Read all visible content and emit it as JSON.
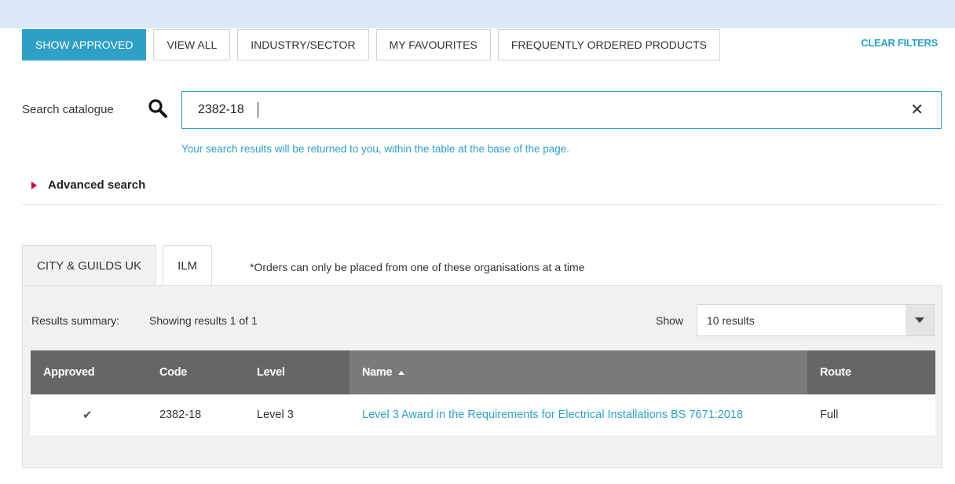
{
  "filters": {
    "show_approved": "SHOW APPROVED",
    "view_all": "VIEW ALL",
    "industry_sector": "INDUSTRY/SECTOR",
    "my_favourites": "MY FAVOURITES",
    "frequently_ordered": "FREQUENTLY ORDERED PRODUCTS",
    "clear_filters": "CLEAR FILTERS",
    "active": "show_approved"
  },
  "search": {
    "label": "Search catalogue",
    "value": "2382-18",
    "clear_glyph": "✕",
    "hint": "Your search results will be returned to you, within the table at the base of the page."
  },
  "advanced": {
    "label": "Advanced search"
  },
  "orgs": {
    "tabs": [
      {
        "label": "CITY & GUILDS UK",
        "active": true
      },
      {
        "label": "ILM",
        "active": false
      }
    ],
    "note": "*Orders can only be placed from one of these organisations at a time"
  },
  "results": {
    "summary_label": "Results summary:",
    "summary_text": "Showing results 1 of 1",
    "show_label": "Show",
    "page_size": "10 results"
  },
  "table": {
    "columns": [
      "Approved",
      "Code",
      "Level",
      "Name",
      "Route"
    ],
    "sort_column": "Name",
    "rows": [
      {
        "approved": "✔",
        "code": "2382-18",
        "level": "Level 3",
        "name": "Level 3 Award in the Requirements for Electrical Installations BS 7671:2018",
        "route": "Full"
      }
    ]
  },
  "colors": {
    "accent": "#2fa0c6",
    "header": "#666666",
    "header_sorted": "#7a7a7a",
    "advanced_arrow": "#d4002a"
  },
  "icons": {
    "search": "search-icon",
    "clear": "close-icon",
    "dropdown": "chevron-down-icon",
    "sort": "sort-ascending-icon",
    "approved": "check-icon"
  }
}
